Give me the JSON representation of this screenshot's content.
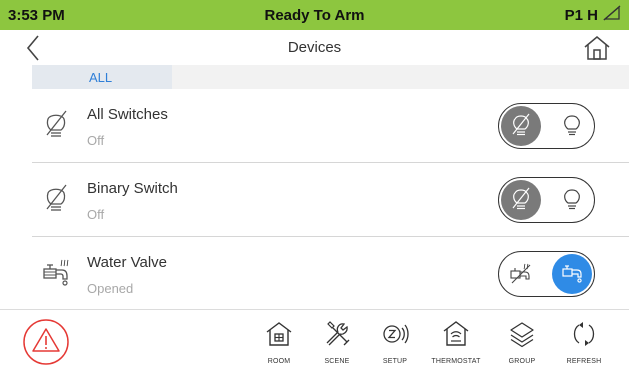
{
  "status_bar": {
    "time": "3:53 PM",
    "title": "Ready To Arm",
    "partition": "P1 H",
    "icon": "no-signal-icon",
    "color": "#8dc63f"
  },
  "nav": {
    "title": "Devices",
    "back_icon": "back-chevron-icon",
    "home_icon": "home-icon"
  },
  "tabs": [
    {
      "label": "ALL",
      "selected": true
    }
  ],
  "devices": [
    {
      "name": "All Switches",
      "state": "Off",
      "icon": "lightbulb-off-icon",
      "toggle": "off"
    },
    {
      "name": "Binary Switch",
      "state": "Off",
      "icon": "lightbulb-off-icon",
      "toggle": "off"
    },
    {
      "name": "Water Valve",
      "state": "Opened",
      "icon": "water-valve-icon",
      "toggle": "on"
    }
  ],
  "bottom_nav": [
    {
      "label": "ROOM",
      "icon": "room-icon"
    },
    {
      "label": "SCENE",
      "icon": "scene-tools-icon"
    },
    {
      "label": "SETUP",
      "icon": "zwave-setup-icon"
    },
    {
      "label": "THERMOSTAT",
      "icon": "thermostat-icon"
    },
    {
      "label": "GROUP",
      "icon": "group-layers-icon"
    },
    {
      "label": "REFRESH",
      "icon": "refresh-icon"
    }
  ],
  "alarm_icon": "alarm-warning-icon",
  "colors": {
    "accent_blue": "#2f8be6",
    "toggle_off_knob": "#7a7a7a",
    "alarm_red": "#e53935"
  }
}
